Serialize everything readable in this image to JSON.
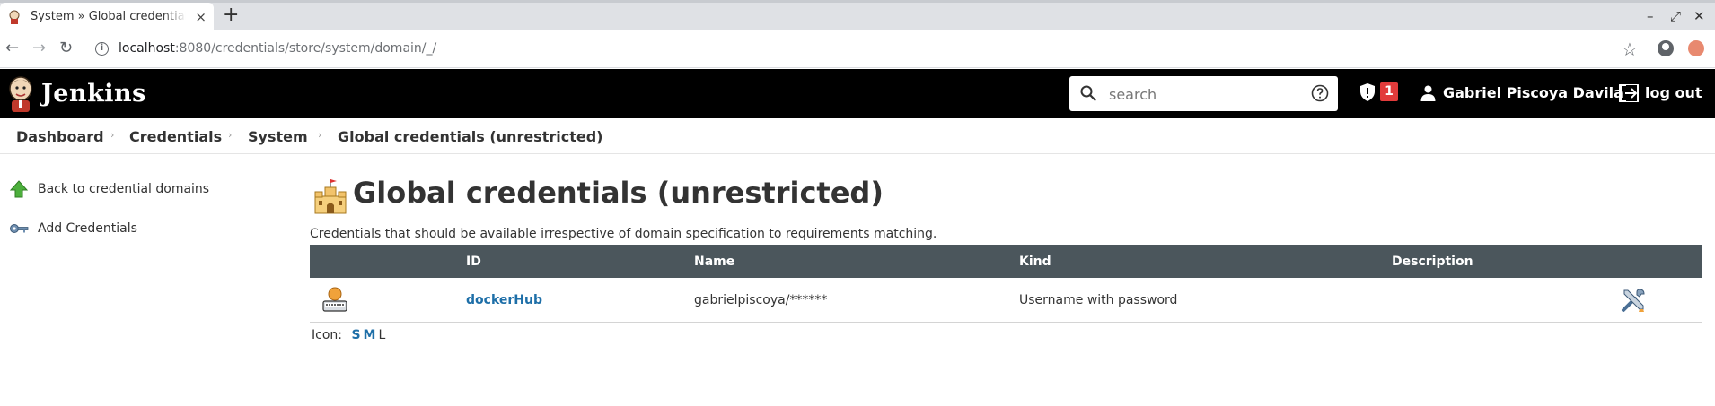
{
  "browser": {
    "tab_title": "System » Global credentials (unrestricted) [Jenkins]",
    "tab_close": "×",
    "new_tab": "+",
    "url_host": "localhost",
    "url_path": ":8080/credentials/store/system/domain/_/",
    "window_controls": [
      "–",
      "⤢",
      "✕"
    ]
  },
  "header": {
    "app_title": "Jenkins",
    "search_placeholder": "search",
    "security_badge": "1",
    "user_name": "Gabriel Piscoya Davila",
    "logout_label": "log out"
  },
  "breadcrumb": [
    {
      "label": "Dashboard"
    },
    {
      "label": "Credentials"
    },
    {
      "label": "System"
    },
    {
      "label": "Global credentials (unrestricted)"
    }
  ],
  "side_panel": {
    "tasks": [
      {
        "label": "Back to credential domains",
        "icon": "up-arrow-icon"
      },
      {
        "label": "Add Credentials",
        "icon": "key-icon"
      }
    ]
  },
  "main": {
    "title": "Global credentials (unrestricted)",
    "description": "Credentials that should be available irrespective of domain specification to requirements matching.",
    "table": {
      "columns": [
        "ID",
        "Name",
        "Kind",
        "Description"
      ],
      "rows": [
        {
          "id": "dockerHub",
          "name": "gabrielpiscoya/******",
          "kind": "Username with password",
          "description": ""
        }
      ]
    },
    "icon_size": {
      "label": "Icon:",
      "options": [
        "S",
        "M",
        "L"
      ]
    }
  },
  "colors": {
    "header_bg": "#000000",
    "table_header_bg": "#4b565c",
    "link": "#1e6fa8",
    "badge": "#e23b3b"
  }
}
